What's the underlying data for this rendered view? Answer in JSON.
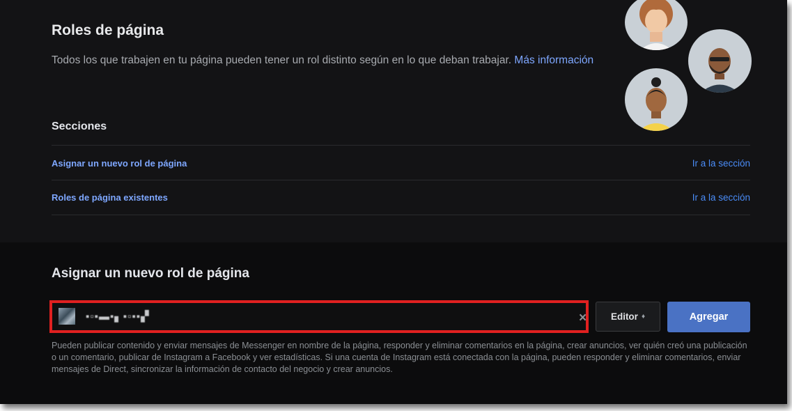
{
  "roles": {
    "title": "Roles de página",
    "description": "Todos los que trabajen en tu página pueden tener un rol distinto según en lo que deban trabajar.",
    "more_info": "Más información"
  },
  "sections": {
    "label": "Secciones",
    "items": [
      {
        "label": "Asignar un nuevo rol de página",
        "goto": "Ir a la sección"
      },
      {
        "label": "Roles de página existentes",
        "goto": "Ir a la sección"
      }
    ]
  },
  "assign": {
    "title": "Asignar un nuevo rol de página",
    "search_value": "▪▫▪▬▪▖▪▫▪▪▞",
    "clear_icon": "×",
    "role_value": "Editor",
    "role_caret": "♦",
    "add_label": "Agregar",
    "help": "Pueden publicar contenido y enviar mensajes de Messenger en nombre de la página, responder y eliminar comentarios en la página, crear anuncios, ver quién creó una publicación o un comentario, publicar de Instagram a Facebook y ver estadísticas. Si una cuenta de Instagram está conectada con la página, pueden responder y eliminar comentarios, enviar mensajes de Direct, sincronizar la información de contacto del negocio y crear anuncios."
  },
  "colors": {
    "accent_link": "#7ea7ff",
    "primary_button": "#4a72c4",
    "highlight_border": "#e02020"
  }
}
